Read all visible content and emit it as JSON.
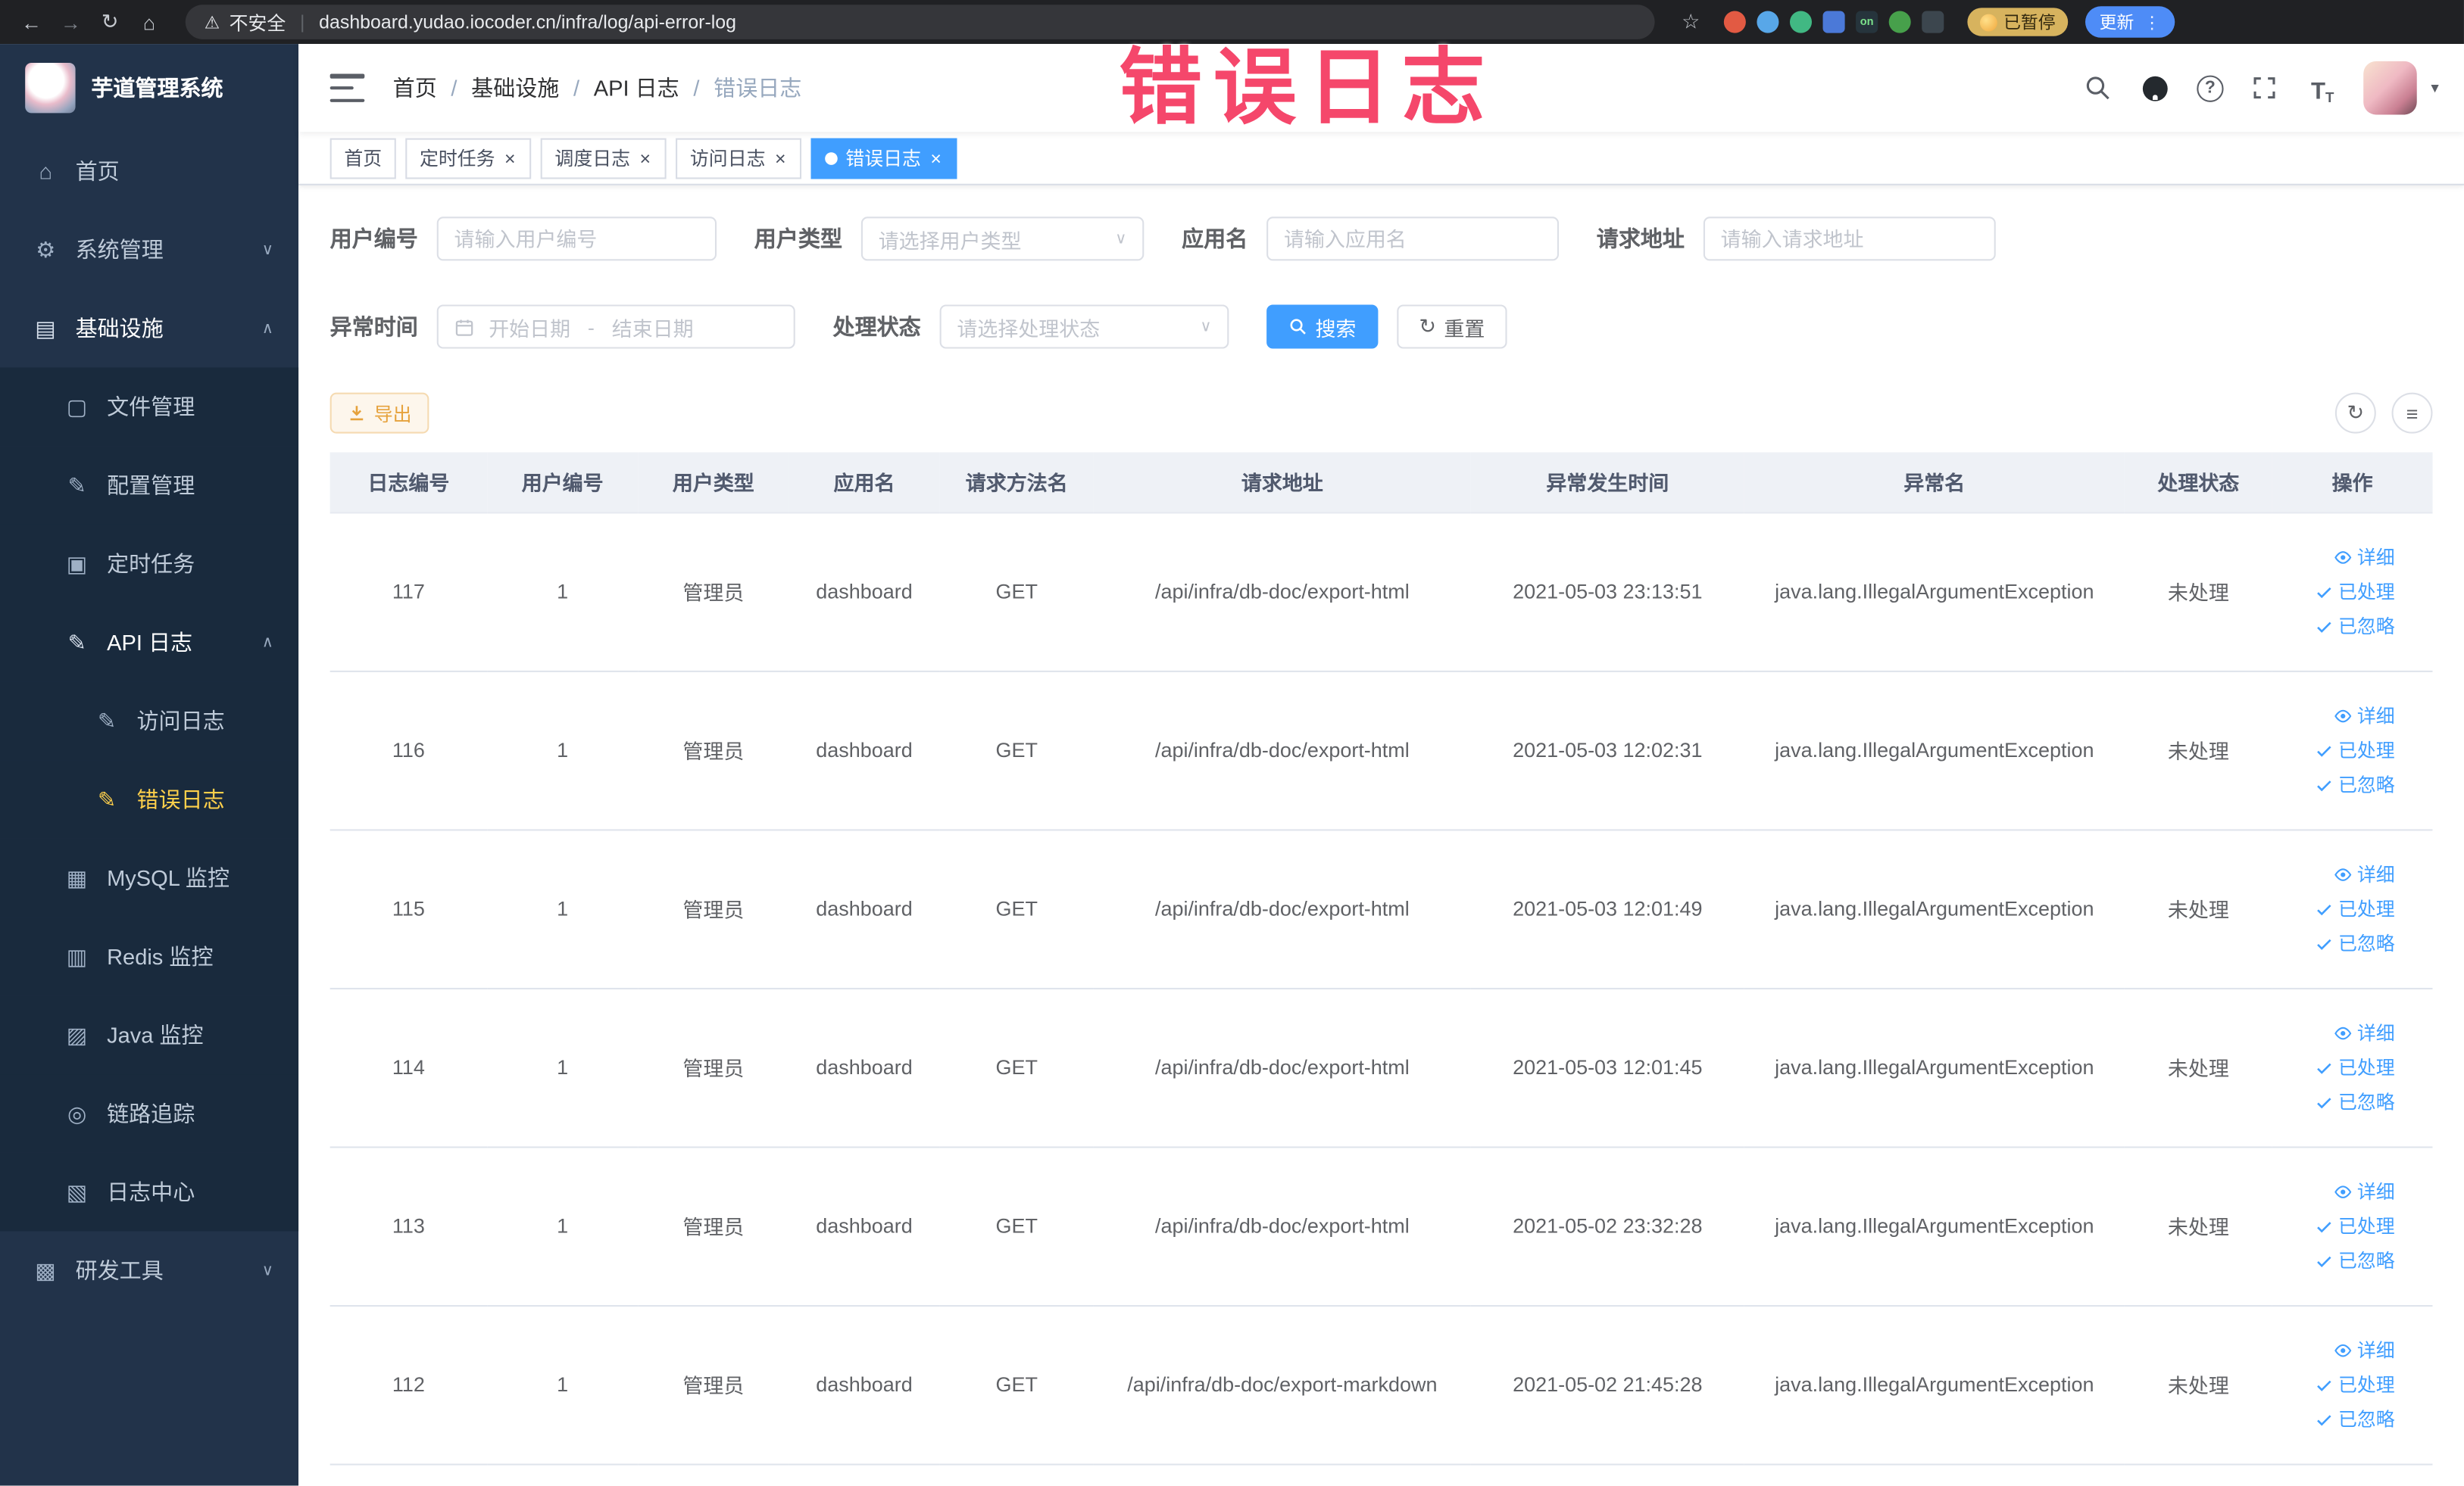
{
  "browser": {
    "security_label": "不安全",
    "url": "dashboard.yudao.iocoder.cn/infra/log/api-error-log",
    "paused_badge": "已暂停",
    "update_button": "更新",
    "extensions": [
      {
        "name": "extension-orange-icon",
        "color": "#e25a43",
        "shape": "circle"
      },
      {
        "name": "extension-blue-icon",
        "color": "#58a7e8",
        "shape": "circle"
      },
      {
        "name": "extension-vue-icon",
        "color": "#41b883",
        "shape": "circle"
      },
      {
        "name": "extension-grid-icon",
        "color": "#4b79d8",
        "shape": "square"
      },
      {
        "name": "extension-on-icon",
        "color": "#26343c",
        "shape": "square",
        "glyph": "on",
        "glyph_color": "#7ce38b"
      },
      {
        "name": "extension-leaf-icon",
        "color": "#47a04b",
        "shape": "circle"
      },
      {
        "name": "extension-dark-icon",
        "color": "#3c464e",
        "shape": "square"
      }
    ]
  },
  "annotation": {
    "text": "错误日志",
    "color": "#f5476b"
  },
  "sidebar": {
    "logo_title": "芋道管理系统",
    "items": [
      {
        "key": "home",
        "label": "首页",
        "icon": "home-icon",
        "level": 1
      },
      {
        "key": "system-mgmt",
        "label": "系统管理",
        "icon": "gear-icon",
        "level": 1,
        "chevron": "down"
      },
      {
        "key": "infrastructure",
        "label": "基础设施",
        "icon": "infra-icon",
        "level": 1,
        "chevron": "up",
        "state": "open-parent"
      },
      {
        "key": "file-mgmt",
        "label": "文件管理",
        "icon": "file-icon",
        "level": 2
      },
      {
        "key": "config-mgmt",
        "label": "配置管理",
        "icon": "config-icon",
        "level": 2
      },
      {
        "key": "scheduled-job",
        "label": "定时任务",
        "icon": "job-icon",
        "level": 2
      },
      {
        "key": "api-log",
        "label": "API 日志",
        "icon": "api-log-icon",
        "level": 2,
        "chevron": "up",
        "state": "open-parent"
      },
      {
        "key": "access-log",
        "label": "访问日志",
        "icon": "access-log-icon",
        "level": 3
      },
      {
        "key": "error-log",
        "label": "错误日志",
        "icon": "error-log-icon",
        "level": 3,
        "state": "active"
      },
      {
        "key": "mysql-monitor",
        "label": "MySQL 监控",
        "icon": "mysql-icon",
        "level": 2
      },
      {
        "key": "redis-monitor",
        "label": "Redis 监控",
        "icon": "redis-icon",
        "level": 2
      },
      {
        "key": "java-monitor",
        "label": "Java 监控",
        "icon": "java-icon",
        "level": 2
      },
      {
        "key": "tracing",
        "label": "链路追踪",
        "icon": "trace-icon",
        "level": 2
      },
      {
        "key": "log-center",
        "label": "日志中心",
        "icon": "log-center-icon",
        "level": 2
      },
      {
        "key": "dev-tools",
        "label": "研发工具",
        "icon": "tools-icon",
        "level": 1,
        "chevron": "down"
      }
    ]
  },
  "breadcrumb": [
    "首页",
    "基础设施",
    "API 日志",
    "错误日志"
  ],
  "tabs": [
    {
      "key": "home",
      "label": "首页",
      "closable": false,
      "active": false
    },
    {
      "key": "job",
      "label": "定时任务",
      "closable": true,
      "active": false
    },
    {
      "key": "job-log",
      "label": "调度日志",
      "closable": true,
      "active": false
    },
    {
      "key": "access-log",
      "label": "访问日志",
      "closable": true,
      "active": false
    },
    {
      "key": "error-log",
      "label": "错误日志",
      "closable": true,
      "active": true
    }
  ],
  "filters": {
    "user_id": {
      "label": "用户编号",
      "placeholder": "请输入用户编号"
    },
    "user_type": {
      "label": "用户类型",
      "placeholder": "请选择用户类型"
    },
    "app_name": {
      "label": "应用名",
      "placeholder": "请输入应用名"
    },
    "request_url": {
      "label": "请求地址",
      "placeholder": "请输入请求地址"
    },
    "exception_time": {
      "label": "异常时间",
      "start_placeholder": "开始日期",
      "separator": "-",
      "end_placeholder": "结束日期"
    },
    "process_status": {
      "label": "处理状态",
      "placeholder": "请选择处理状态"
    },
    "search_button": "搜索",
    "reset_button": "重置"
  },
  "toolbar": {
    "export_button": "导出"
  },
  "table": {
    "columns": [
      "日志编号",
      "用户编号",
      "用户类型",
      "应用名",
      "请求方法名",
      "请求地址",
      "异常发生时间",
      "异常名",
      "处理状态",
      "操作"
    ],
    "actions": [
      {
        "key": "detail",
        "label": "详细",
        "icon": "eye-icon"
      },
      {
        "key": "processed",
        "label": "已处理",
        "icon": "check-icon"
      },
      {
        "key": "ignored",
        "label": "已忽略",
        "icon": "check-icon"
      }
    ],
    "rows": [
      {
        "id": "117",
        "user_id": "1",
        "user_type": "管理员",
        "app": "dashboard",
        "method": "GET",
        "url": "/api/infra/db-doc/export-html",
        "time": "2021-05-03 23:13:51",
        "exception": "java.lang.IllegalArgumentException",
        "status": "未处理"
      },
      {
        "id": "116",
        "user_id": "1",
        "user_type": "管理员",
        "app": "dashboard",
        "method": "GET",
        "url": "/api/infra/db-doc/export-html",
        "time": "2021-05-03 12:02:31",
        "exception": "java.lang.IllegalArgumentException",
        "status": "未处理"
      },
      {
        "id": "115",
        "user_id": "1",
        "user_type": "管理员",
        "app": "dashboard",
        "method": "GET",
        "url": "/api/infra/db-doc/export-html",
        "time": "2021-05-03 12:01:49",
        "exception": "java.lang.IllegalArgumentException",
        "status": "未处理"
      },
      {
        "id": "114",
        "user_id": "1",
        "user_type": "管理员",
        "app": "dashboard",
        "method": "GET",
        "url": "/api/infra/db-doc/export-html",
        "time": "2021-05-03 12:01:45",
        "exception": "java.lang.IllegalArgumentException",
        "status": "未处理"
      },
      {
        "id": "113",
        "user_id": "1",
        "user_type": "管理员",
        "app": "dashboard",
        "method": "GET",
        "url": "/api/infra/db-doc/export-html",
        "time": "2021-05-02 23:32:28",
        "exception": "java.lang.IllegalArgumentException",
        "status": "未处理"
      },
      {
        "id": "112",
        "user_id": "1",
        "user_type": "管理员",
        "app": "dashboard",
        "method": "GET",
        "url": "/api/infra/db-doc/export-markdown",
        "time": "2021-05-02 21:45:28",
        "exception": "java.lang.IllegalArgumentException",
        "status": "未处理"
      }
    ]
  },
  "colors": {
    "primary": "#409eff",
    "sidebar_bg": "#22334a",
    "submenu_bg": "#192a3d",
    "active_menu_text": "#ffd04b",
    "warning": "#e6a23c",
    "annotation": "#f5476b"
  }
}
